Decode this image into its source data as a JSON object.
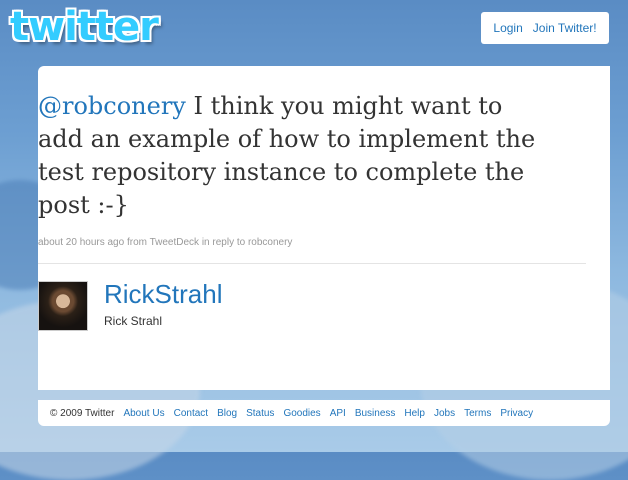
{
  "header": {
    "logo_text": "twitter",
    "login_label": "Login",
    "join_label": "Join Twitter!"
  },
  "tweet": {
    "mention": "@robconery",
    "text": " I think you might want to add an example of how to implement the test repository instance to complete the post :-}",
    "timestamp": "about 20 hours ago",
    "from_prefix": "from",
    "source": "TweetDeck",
    "reply_prefix": "in reply to",
    "reply_to": "robconery"
  },
  "author": {
    "screen_name": "RickStrahl",
    "full_name": "Rick Strahl"
  },
  "footer": {
    "copyright": "© 2009 Twitter",
    "links": [
      "About Us",
      "Contact",
      "Blog",
      "Status",
      "Goodies",
      "API",
      "Business",
      "Help",
      "Jobs",
      "Terms",
      "Privacy"
    ]
  },
  "colors": {
    "link": "#2276bb",
    "logo": "#33ccff",
    "background": "#6d9fd2"
  }
}
